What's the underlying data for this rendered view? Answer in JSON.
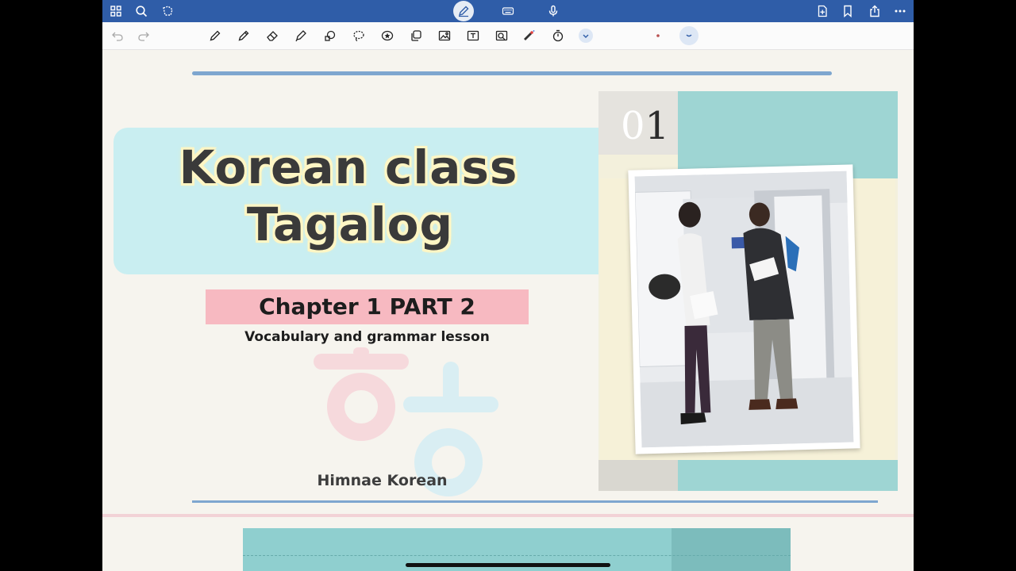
{
  "topbar": {
    "left_icons": [
      "grid-icon",
      "search-icon",
      "lasso-select-icon"
    ],
    "center_icons": [
      "pen-mode-icon",
      "keyboard-icon",
      "microphone-icon"
    ],
    "right_icons": [
      "add-page-icon",
      "bookmark-icon",
      "share-icon",
      "more-icon"
    ],
    "bg_color": "#2f5da8"
  },
  "toolbar": {
    "tools": [
      "undo-icon",
      "redo-icon",
      "pen-icon",
      "pencil-icon",
      "eraser-icon",
      "highlighter-icon",
      "shape-icon",
      "lasso-icon",
      "sticker-icon",
      "copy-icon",
      "image-icon",
      "text-icon",
      "camera-icon",
      "laser-pointer-icon",
      "timer-icon",
      "dropdown-icon",
      "color-dot",
      "collapse-icon"
    ]
  },
  "slide": {
    "title_line1": "Korean class",
    "title_line2": "Tagalog",
    "chapter": "Chapter 1 PART 2",
    "subtitle": "Vocabulary and grammar lesson",
    "brand": "Himnae Korean",
    "photo_number_first": "0",
    "photo_number_second": "1",
    "colors": {
      "title_band": "#c9eef1",
      "chapter_band": "#f7b9c1",
      "rule": "#7ea6cf",
      "teal": "#9ed5d3"
    }
  }
}
